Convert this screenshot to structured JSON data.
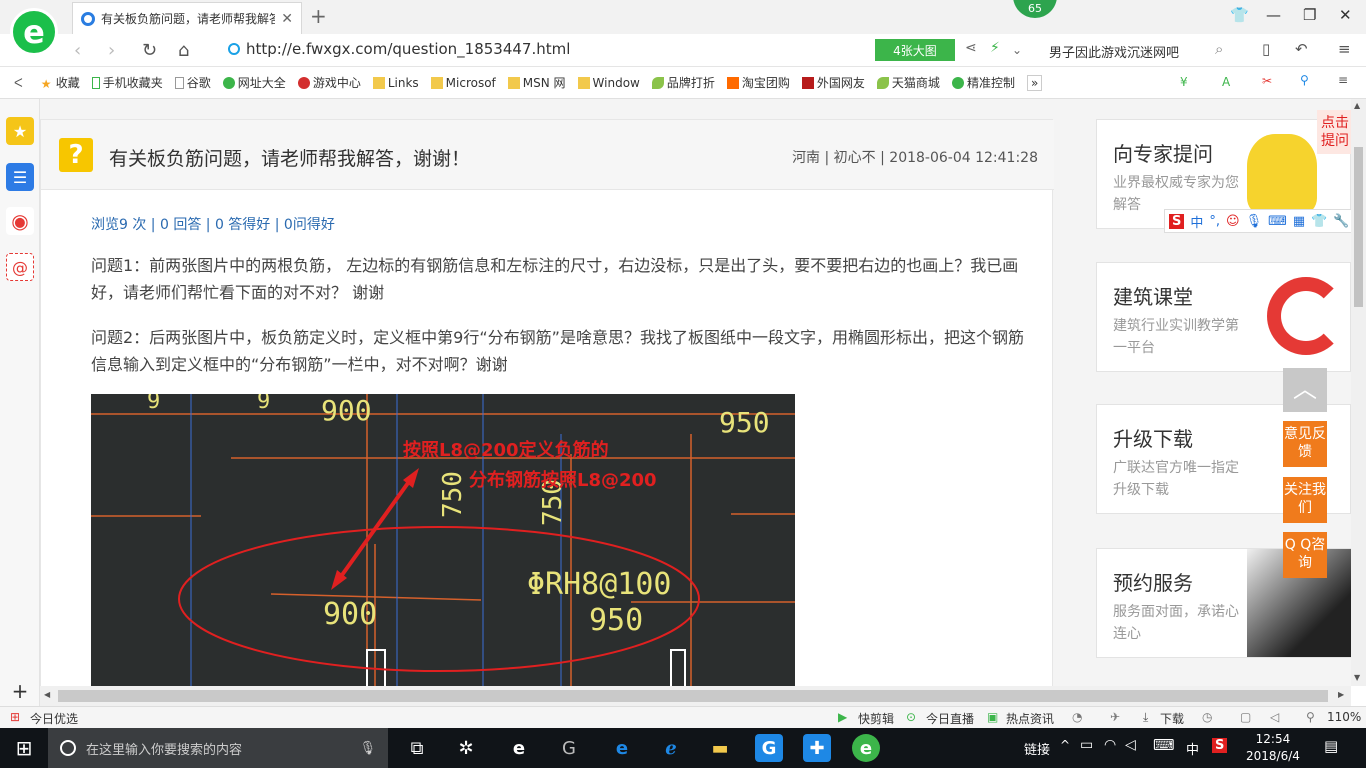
{
  "browser": {
    "tab_title": "有关板负筋问题，请老师帮我解答",
    "badge": "65",
    "url": "http://e.fwxgx.com/question_1853447.html",
    "big_image_label": "4张大图",
    "hot_search": "男子因此游戏沉迷网吧"
  },
  "bookmarks": [
    "收藏",
    "手机收藏夹",
    "谷歌",
    "网址大全",
    "游戏中心",
    "Links",
    "Microsof",
    "MSN 网",
    "Window",
    "品牌打折",
    "淘宝团购",
    "外国网友",
    "天猫商城",
    "精准控制"
  ],
  "question": {
    "title": "有关板负筋问题，请老师帮我解答，谢谢！",
    "meta": "河南 | 初心不 | 2018-06-04 12:41:28",
    "stats": "浏览9 次 | 0 回答 | 0 答得好 | 0问得好",
    "p1": "问题1：前两张图片中的两根负筋， 左边标的有钢筋信息和左标注的尺寸，右边没标，只是出了头，要不要把右边的也画上？我已画好，请老师们帮忙看下面的对不对？ 谢谢",
    "p2": "问题2：后两张图片中，板负筋定义时，定义框中第9行“分布钢筋”是啥意思？我找了板图纸中一段文字，用椭圆形标出，把这个钢筋信息输入到定义框中的“分布钢筋”一栏中，对不对啊？谢谢"
  },
  "drawing": {
    "annot1": "按照L8@200定义负筋的",
    "annot2": "分布钢筋按照L8@200",
    "dim_900_top": "900",
    "dim_950_top": "950",
    "dim_750_a": "750",
    "dim_750_b": "750",
    "dim_900": "900",
    "rebar": "ΦRH8@100",
    "dim_950": "950",
    "left_9a": "9",
    "left_9b": "9"
  },
  "sidebar_right": {
    "card1_title": "向专家提问",
    "card1_sub": "业界最权威专家为您解答",
    "card2_title": "建筑课堂",
    "card2_sub": "建筑行业实训教学第一平台",
    "card3_title": "升级下载",
    "card3_sub": "广联达官方唯一指定升级下载",
    "card4_title": "预约服务",
    "card4_sub": "服务面对面，承诺心连心",
    "ad_tag": "点击提问",
    "ime_label": "中"
  },
  "float_buttons": [
    "意见反馈",
    "关注我们",
    "Q Q咨询"
  ],
  "statusbar": {
    "left": "今日优选",
    "items": [
      "快剪辑",
      "今日直播",
      "热点资讯",
      "下载"
    ],
    "zoom": "110%"
  },
  "taskbar": {
    "search_placeholder": "在这里输入你要搜索的内容",
    "link_label": "链接",
    "ime": "中",
    "time": "12:54",
    "date": "2018/6/4"
  },
  "colors": {
    "accent_green": "#1bbf4a",
    "link_blue": "#2a6ab0",
    "orange": "#f07b1c",
    "annot_red": "#e02020",
    "cad_yellow": "#e8e37a"
  }
}
